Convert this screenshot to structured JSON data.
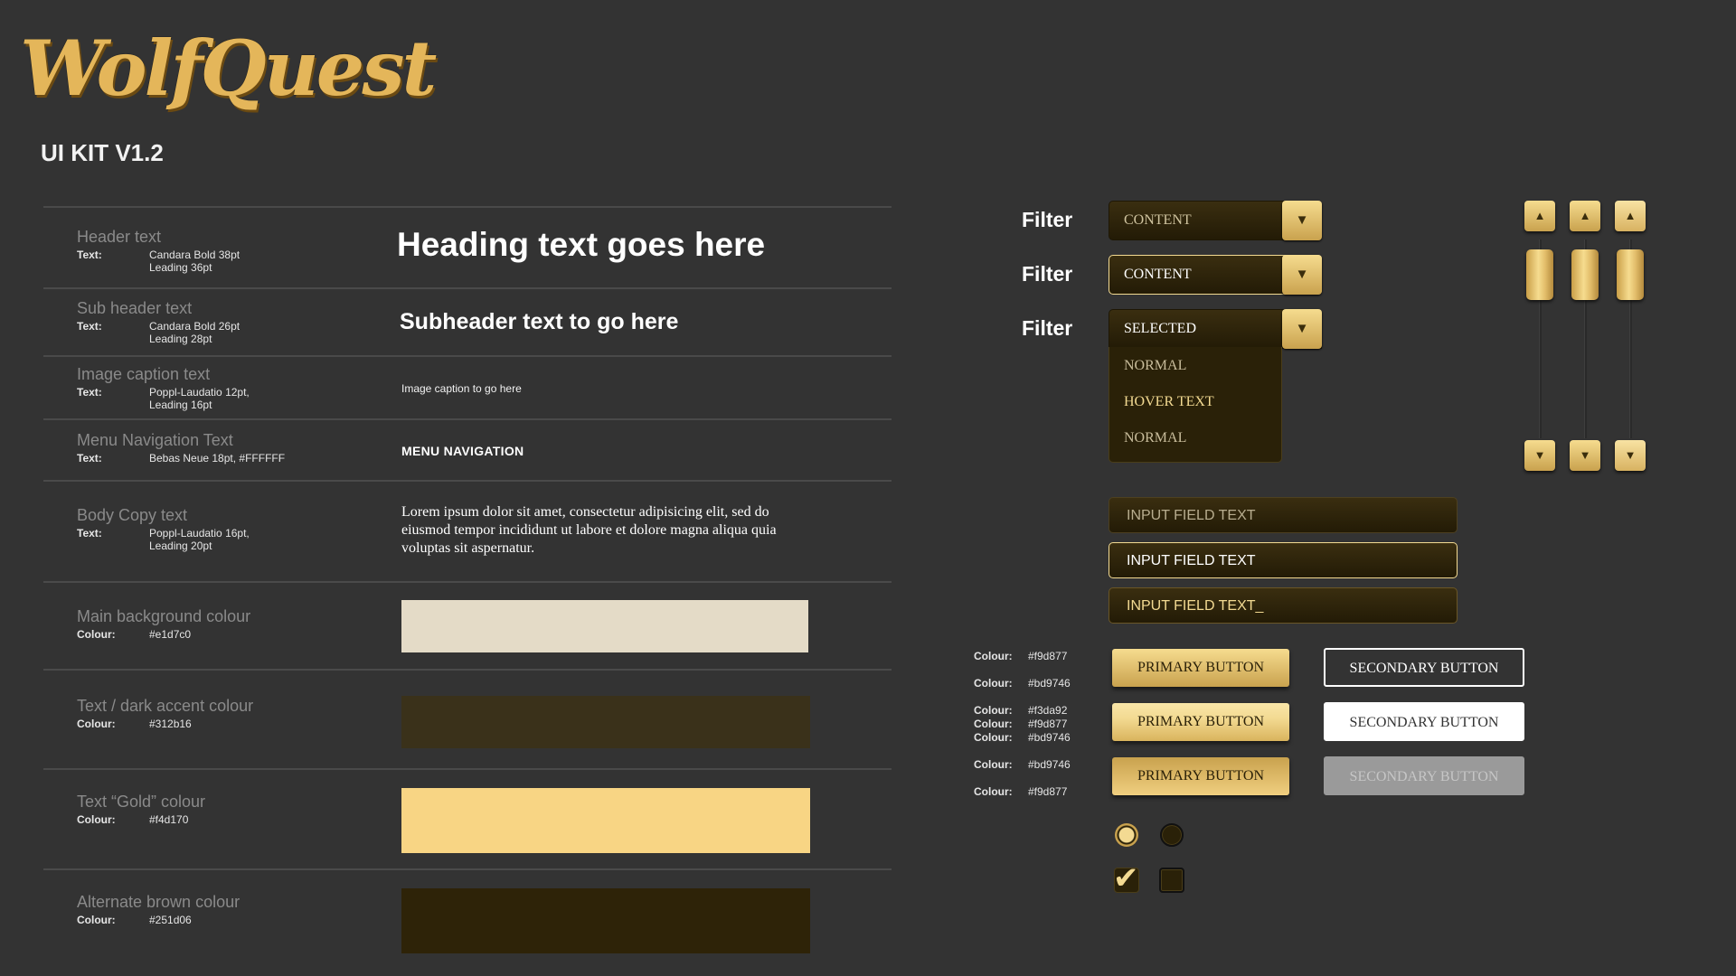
{
  "brand": {
    "logo_text": "WolfQuest",
    "kit_title": "UI KIT V1.2"
  },
  "specs": {
    "header": {
      "label": "Header text",
      "key": "Text:",
      "line1": "Candara Bold 38pt",
      "line2": "Leading 36pt",
      "demo": "Heading text goes here"
    },
    "subheader": {
      "label": "Sub header text",
      "key": "Text:",
      "line1": "Candara Bold 26pt",
      "line2": "Leading 28pt",
      "demo": "Subheader text to go here"
    },
    "caption": {
      "label": "Image caption text",
      "key": "Text:",
      "line1": "Poppl-Laudatio 12pt,",
      "line2": "Leading 16pt",
      "demo": "Image caption to go here"
    },
    "menu": {
      "label": "Menu Navigation Text",
      "key": "Text:",
      "line1": "Bebas Neue 18pt, #FFFFFF",
      "demo": "MENU NAVIGATION"
    },
    "body": {
      "label": "Body Copy text",
      "key": "Text:",
      "line1": "Poppl-Laudatio 16pt,",
      "line2": "Leading 20pt",
      "demo": "Lorem ipsum dolor sit amet, consectetur adipisicing elit, sed do eiusmod tempor incididunt ut labore et dolore magna aliqua quia voluptas sit aspernatur."
    }
  },
  "colours": [
    {
      "label": "Main background colour",
      "key": "Colour:",
      "value": "#e1d7c0",
      "swatch": "#e4dbc7"
    },
    {
      "label": "Text / dark accent colour",
      "key": "Colour:",
      "value": "#312b16",
      "swatch": "#3a311a"
    },
    {
      "label": "Text “Gold” colour",
      "key": "Colour:",
      "value": "#f4d170",
      "swatch": "#f8d584"
    },
    {
      "label": "Alternate brown colour",
      "key": "Colour:",
      "value": "#251d06",
      "swatch": "#2e2308"
    }
  ],
  "filters": [
    {
      "label": "Filter",
      "value": "CONTENT",
      "state": "normal"
    },
    {
      "label": "Filter",
      "value": "CONTENT",
      "state": "active"
    },
    {
      "label": "Filter",
      "value": "SELECTED",
      "state": "open"
    }
  ],
  "dropdown_options": [
    "NORMAL",
    "HOVER TEXT",
    "NORMAL"
  ],
  "inputs": [
    {
      "value": "INPUT FIELD TEXT",
      "state": "normal"
    },
    {
      "value": "INPUT FIELD TEXT",
      "state": "focus"
    },
    {
      "value": "INPUT FIELD TEXT_",
      "state": "typing"
    }
  ],
  "button_colours": {
    "key": "Colour:",
    "row1": [
      "#f9d877",
      "#bd9746"
    ],
    "row2": [
      "#f3da92",
      "#f9d877",
      "#bd9746"
    ],
    "row3": [
      "#bd9746",
      "#f9d877"
    ]
  },
  "buttons": {
    "primary": [
      "PRIMARY BUTTON",
      "PRIMARY BUTTON",
      "PRIMARY BUTTON"
    ],
    "secondary": [
      "SECONDARY BUTTON",
      "SECONDARY BUTTON",
      "SECONDARY BUTTON"
    ]
  },
  "icons": {
    "dropdown_arrow": "▼",
    "slider_up": "▲",
    "slider_down": "▼",
    "check": "✔"
  },
  "theme": {
    "gold": "#f4d170",
    "dark": "#312b16",
    "brown": "#251d06",
    "bg": "#333333"
  }
}
